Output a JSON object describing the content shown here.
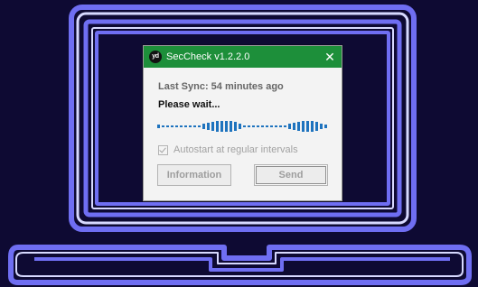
{
  "colors": {
    "background": "#0e0a33",
    "laptop_outline": "#6e6cf0",
    "laptop_inner": "#d6d8ff",
    "titlebar": "#1d8f3a",
    "progress": "#1e73be"
  },
  "window": {
    "title": "SecCheck v1.2.2.0",
    "logo_text": "yd",
    "close_symbol": "✕"
  },
  "status": {
    "last_sync": "Last Sync: 54 minutes ago",
    "message": "Please wait..."
  },
  "autostart": {
    "label": "Autostart at regular intervals",
    "checked": true,
    "disabled": true
  },
  "buttons": {
    "information_label": "Information",
    "send_label": "Send"
  },
  "icons": {
    "app": "app-logo-icon",
    "close": "close-icon",
    "checkbox": "checkmark-icon"
  }
}
